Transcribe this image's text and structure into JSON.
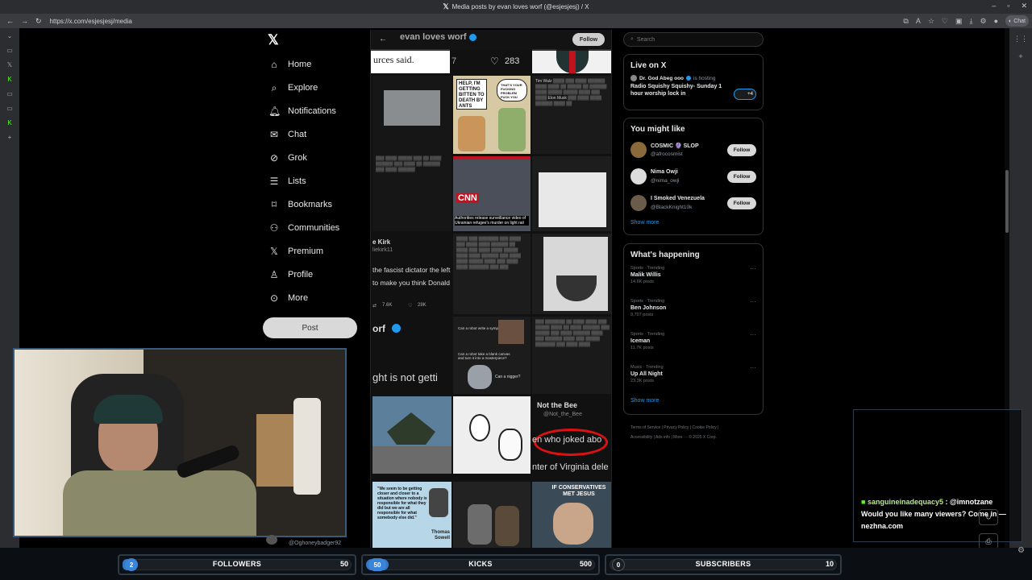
{
  "browser": {
    "title": "Media posts by evan loves worf (@esjesjesj) / X",
    "url": "https://x.com/esjesjesj/media",
    "chat_label": "Chat"
  },
  "nav": {
    "items": [
      {
        "label": "Home",
        "icon": "home-icon"
      },
      {
        "label": "Explore",
        "icon": "search-icon"
      },
      {
        "label": "Notifications",
        "icon": "bell-icon"
      },
      {
        "label": "Chat",
        "icon": "mail-icon"
      },
      {
        "label": "Grok",
        "icon": "grok-icon"
      },
      {
        "label": "Lists",
        "icon": "list-icon"
      },
      {
        "label": "Bookmarks",
        "icon": "bookmark-icon"
      },
      {
        "label": "Communities",
        "icon": "communities-icon"
      },
      {
        "label": "Premium",
        "icon": "x-premium-icon"
      },
      {
        "label": "Profile",
        "icon": "person-icon"
      },
      {
        "label": "More",
        "icon": "more-icon"
      }
    ],
    "post_label": "Post",
    "below_cam_handle": "@Oghoneybadger92"
  },
  "profile_header": {
    "name": "evan loves worf",
    "follow_label": "Follow"
  },
  "media_tiles": {
    "t1_text": "urces said.",
    "t1_count": "283",
    "t1_count_prefix": "7",
    "ants_caption": "HELP, I'M GETTING BITTEN TO DEATH BY ANTS",
    "ants_reply": "THAT'S YOUR FUCKING PROBLEM FUCK YOU",
    "cnn_caption": "Authorities release surveillance video of Ukrainian refugee's murder on light rail",
    "kirk_name": "e Kirk",
    "kirk_handle": "liekirk11",
    "kirk_body_1": "the fascist dictator the left t",
    "kirk_body_2": "to make you think Donald Tr",
    "kirk_stats_a": "7.6K",
    "kirk_stats_b": "28K",
    "worf_text": "orf",
    "getting_text": "ght is not getti",
    "robot_q1": "Can a robot write a symphony?",
    "robot_q2": "Can a robot take a blank canvas and turn it into a masterpiece?",
    "robot_q3": "Can a nigger?",
    "bee_name": "Not the Bee",
    "bee_handle": "@Not_the_Bee",
    "bee_line1": "en who joked abo",
    "bee_line2": "nter of Virginia dele",
    "sowell_quote": "\"We seem to be getting closer and closer to a situation where nobody is responsible for what they did but we are all responsible for what somebody else did.\"",
    "sowell_name": "Thomas Sowell",
    "conservatives_caption": "IF CONSERVATIVES MET JESUS"
  },
  "right": {
    "search_placeholder": "Search",
    "live_title": "Live on X",
    "live_host": "Dr. God Abeg ooo",
    "live_hosting": "is hosting",
    "live_show": "Radio Squishy Squishy- Sunday 1 hour worship lock in",
    "live_badge": "+4",
    "wtf_title": "You might like",
    "suggestions": [
      {
        "name": "COSMIC 🔮 SLOP",
        "handle": "@afrocosmist",
        "button": "Follow",
        "color": "#8a6a3a"
      },
      {
        "name": "Nima Owji",
        "handle": "@nima_owji",
        "button": "Follow",
        "color": "#dcdcdc"
      },
      {
        "name": "I Smoked Venezuela",
        "handle": "@BlackKnight10k",
        "button": "Follow",
        "color": "#6b5b4b"
      }
    ],
    "show_more": "Show more",
    "happening_title": "What's happening",
    "trends": [
      {
        "category": "Sports · Trending",
        "title": "Malik Willis",
        "posts": "14.6K posts"
      },
      {
        "category": "Sports · Trending",
        "title": "Ben Johnson",
        "posts": "9,707 posts"
      },
      {
        "category": "Sports · Trending",
        "title": "Iceman",
        "posts": "11.7K posts"
      },
      {
        "category": "Music · Trending",
        "title": "Up All Night",
        "posts": "23.3K posts"
      }
    ],
    "footer_line1": "Terms of Service | Privacy Policy | Cookie Policy |",
    "footer_line2": "Accessibility | Ads info | More ··· © 2025 X Corp."
  },
  "stream": {
    "followers": {
      "label": "FOLLOWERS",
      "current": "2",
      "goal": "50",
      "progress": 0.04
    },
    "kicks": {
      "label": "KICKS",
      "current": "50",
      "goal": "500",
      "progress": 0.1
    },
    "subscribers": {
      "label": "SUBSCRIBERS",
      "current": "0",
      "goal": "10",
      "progress": 0.0
    },
    "chat_user": "sanguineinadequacy5",
    "chat_mention": ": @imnotzane",
    "chat_text": "Would you like many viewers? Come in — nezhna.com"
  },
  "colors": {
    "accent": "#1d9bf0",
    "bar_fill": "#3577c9",
    "chat_user": "#b8e986"
  }
}
